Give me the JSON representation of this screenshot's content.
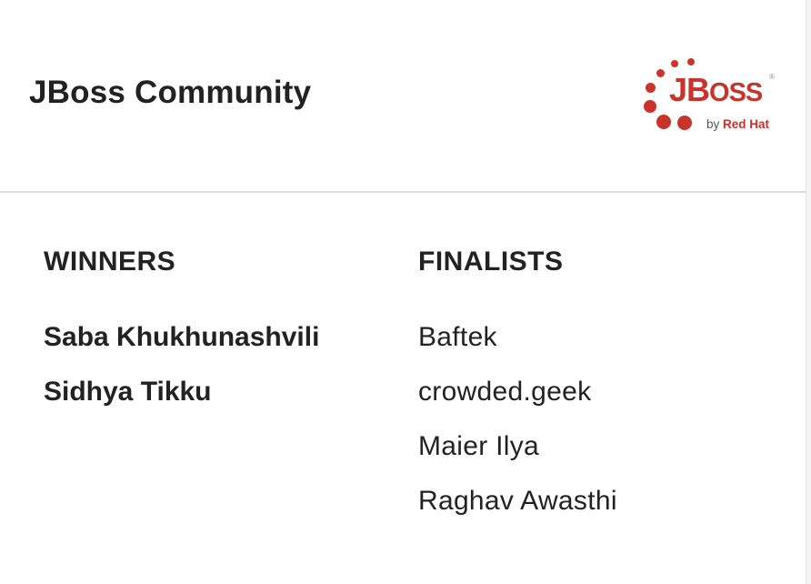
{
  "header": {
    "title": "JBoss Community",
    "logo": {
      "wordmark_j": "J",
      "wordmark_b": "B",
      "wordmark_rest": "OSS",
      "registered": "®",
      "by": "by",
      "red_hat": "Red Hat",
      "brand_color": "#c8342c"
    }
  },
  "winners": {
    "heading": "WINNERS",
    "names": [
      "Saba Khukhunashvili",
      "Sidhya Tikku"
    ]
  },
  "finalists": {
    "heading": "FINALISTS",
    "names": [
      "Baftek",
      "crowded.geek",
      "Maier Ilya",
      "Raghav Awasthi"
    ]
  }
}
